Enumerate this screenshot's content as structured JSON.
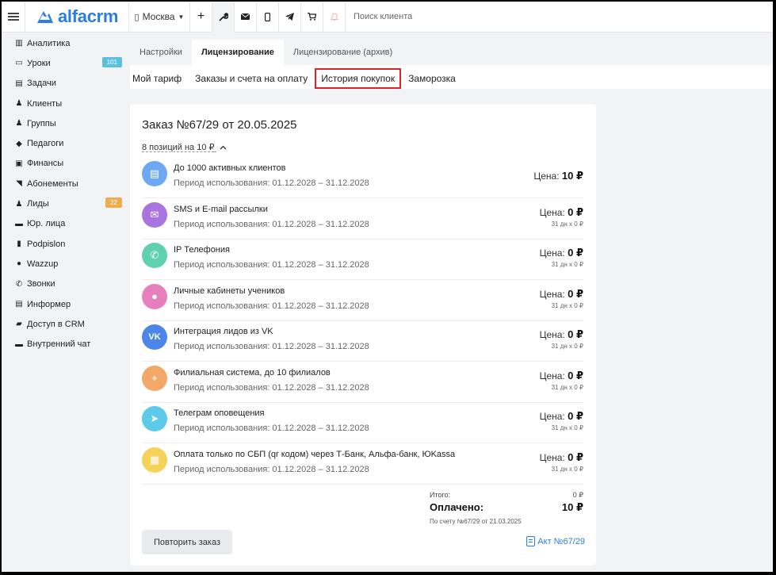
{
  "topbar": {
    "logo": "alfacrm",
    "city": "Москва",
    "search_placeholder": "Поиск клиента",
    "icons": [
      "plus-icon",
      "wrench-icon",
      "mail-icon",
      "phone-icon",
      "telegram-icon",
      "cart-icon",
      "bell-icon"
    ]
  },
  "sidebar": {
    "items": [
      {
        "label": "Аналитика",
        "icon": "chart-icon"
      },
      {
        "label": "Уроки",
        "icon": "calendar-icon",
        "badge": "101",
        "badge_color": "#5bc0de"
      },
      {
        "label": "Задачи",
        "icon": "tasks-icon"
      },
      {
        "label": "Клиенты",
        "icon": "user-icon"
      },
      {
        "label": "Группы",
        "icon": "group-icon"
      },
      {
        "label": "Педагоги",
        "icon": "graduation-icon"
      },
      {
        "label": "Финансы",
        "icon": "money-icon"
      },
      {
        "label": "Абонементы",
        "icon": "tag-icon"
      },
      {
        "label": "Лиды",
        "icon": "user-plus-icon",
        "badge": "22",
        "badge_color": "#f0ad4e"
      },
      {
        "label": "Юр. лица",
        "icon": "briefcase-icon"
      },
      {
        "label": "Podpislon",
        "icon": "document-icon"
      },
      {
        "label": "Wazzup",
        "icon": "whatsapp-icon"
      },
      {
        "label": "Звонки",
        "icon": "phone-icon"
      },
      {
        "label": "Информер",
        "icon": "list-icon"
      },
      {
        "label": "Доступ в CRM",
        "icon": "lock-icon"
      },
      {
        "label": "Внутренний чат",
        "icon": "mail-icon"
      }
    ]
  },
  "tabs_main": [
    {
      "label": "Настройки",
      "active": false
    },
    {
      "label": "Лицензирование",
      "active": true
    },
    {
      "label": "Лицензирование (архив)",
      "active": false
    }
  ],
  "tabs_sub": [
    {
      "label": "Мой тариф"
    },
    {
      "label": "Заказы и счета на оплату"
    },
    {
      "label": "История покупок",
      "highlighted": true
    },
    {
      "label": "Заморозка"
    }
  ],
  "order": {
    "title_prefix": "Заказ №67/29",
    "title_suffix": "от 20.05.2025",
    "positions": "8 позиций на 10 ₽",
    "price_label": "Цена:",
    "items": [
      {
        "name": "До 1000 активных клиентов",
        "period": "Период использования: 01.12.2028 – 31.12.2028",
        "price": "10 ₽",
        "calc": "",
        "color": "#6ea8f2",
        "icon": "clipboard-icon",
        "glyph": "▤"
      },
      {
        "name": "SMS и E-mail рассылки",
        "period": "Период использования: 01.12.2028 – 31.12.2028",
        "price": "0 ₽",
        "calc": "31 дн x 0 ₽",
        "color": "#a974e0",
        "icon": "envelope-icon",
        "glyph": "✉"
      },
      {
        "name": "IP Телефония",
        "period": "Период использования: 01.12.2028 – 31.12.2028",
        "price": "0 ₽",
        "calc": "31 дн x 0 ₽",
        "color": "#5fd1b0",
        "icon": "phone-icon",
        "glyph": "✆"
      },
      {
        "name": "Личные кабинеты учеников",
        "period": "Период использования: 01.12.2028 – 31.12.2028",
        "price": "0 ₽",
        "calc": "31 дн x 0 ₽",
        "color": "#e77fbf",
        "icon": "person-icon",
        "glyph": "●"
      },
      {
        "name": "Интеграция лидов из VK",
        "period": "Период использования: 01.12.2028 – 31.12.2028",
        "price": "0 ₽",
        "calc": "31 дн x 0 ₽",
        "color": "#4c86e8",
        "icon": "vk-icon",
        "glyph": "VK"
      },
      {
        "name": "Филиальная система, до 10 филиалов",
        "period": "Период использования: 01.12.2028 – 31.12.2028",
        "price": "0 ₽",
        "calc": "31 дн x 0 ₽",
        "color": "#f3a86a",
        "icon": "location-icon",
        "glyph": "⌖"
      },
      {
        "name": "Телеграм оповещения",
        "period": "Период использования: 01.12.2028 – 31.12.2028",
        "price": "0 ₽",
        "calc": "31 дн x 0 ₽",
        "color": "#5dcaea",
        "icon": "telegram-icon",
        "glyph": "➤"
      },
      {
        "name": "Оплата только по СБП (qr кодом) через Т-Банк, Альфа-банк, ЮKassa",
        "period": "Период использования: 01.12.2028 – 31.12.2028",
        "price": "0 ₽",
        "calc": "31 дн x 0 ₽",
        "color": "#f5d35a",
        "icon": "qr-icon",
        "glyph": "▦"
      }
    ],
    "total_label": "Итого:",
    "total_value": "0 ₽",
    "paid_label": "Оплачено:",
    "paid_value": "10 ₽",
    "invoice_note": "По счету №67/29 от 21.03.2025",
    "repeat_button": "Повторить заказ",
    "act_link": "Акт №67/29"
  }
}
